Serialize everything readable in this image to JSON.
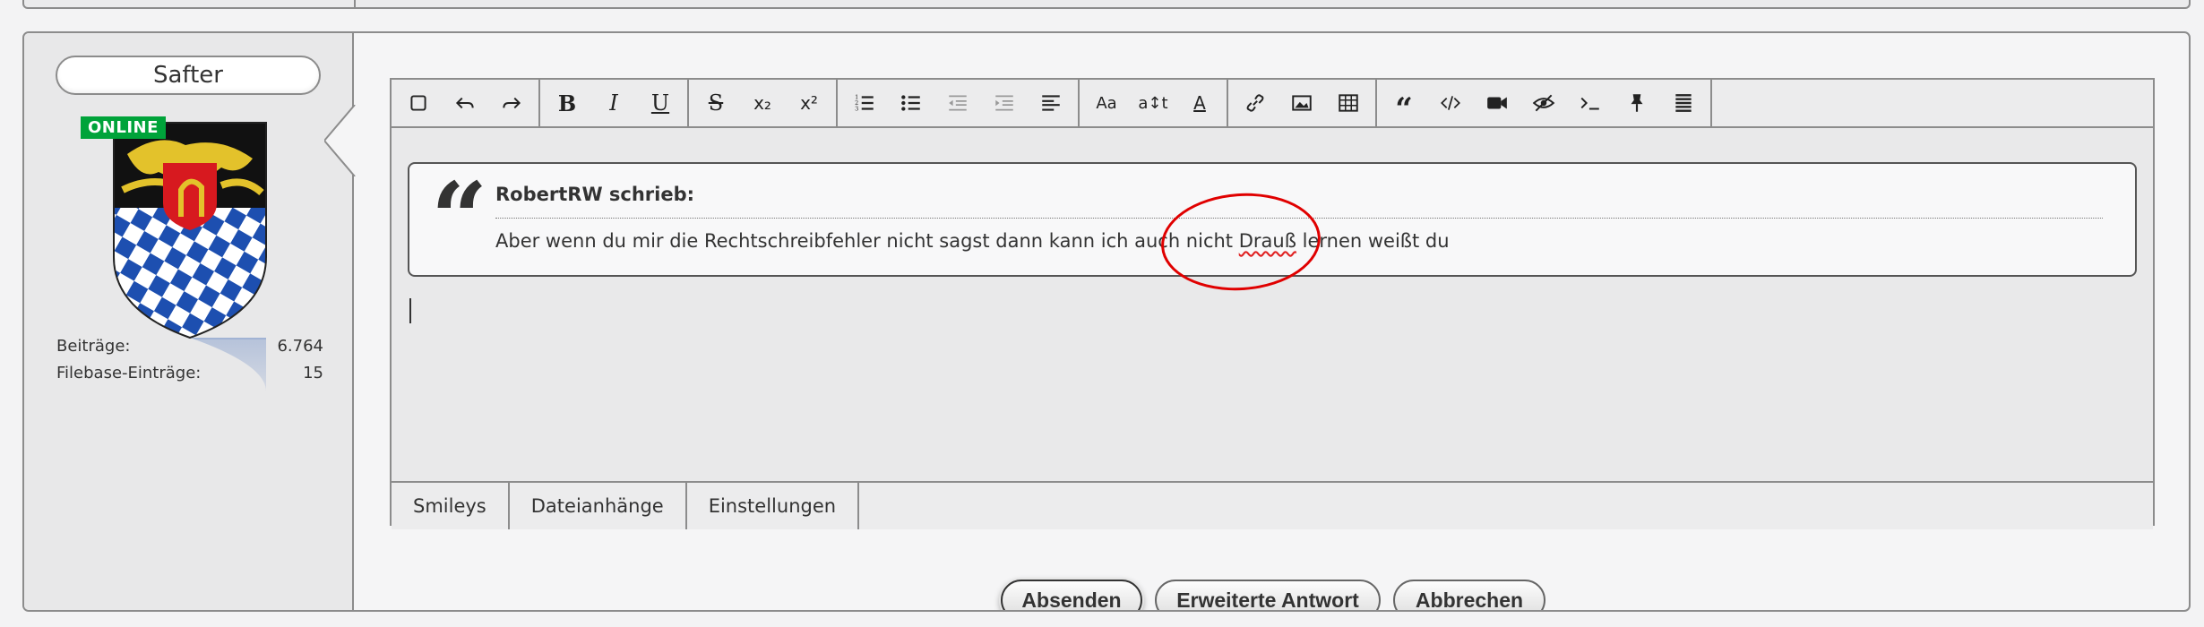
{
  "user": {
    "name": "Safter",
    "online_badge": "ONLINE",
    "stats": [
      {
        "label": "Beiträge:",
        "value": "6.764"
      },
      {
        "label": "Filebase-Einträge:",
        "value": "15"
      }
    ]
  },
  "toolbar": {
    "groups": [
      [
        "checkbox-icon",
        "undo-icon",
        "redo-icon"
      ],
      [
        "bold-icon",
        "italic-icon",
        "underline-icon"
      ],
      [
        "strikethrough-icon",
        "subscript-icon",
        "superscript-icon"
      ],
      [
        "ordered-list-icon",
        "unordered-list-icon",
        "outdent-icon",
        "indent-icon",
        "align-icon"
      ],
      [
        "font-family-icon",
        "font-size-icon",
        "font-color-icon"
      ],
      [
        "link-icon",
        "image-icon",
        "table-icon"
      ],
      [
        "quote-icon",
        "code-icon",
        "video-icon",
        "spoiler-icon",
        "inline-code-icon",
        "pin-icon",
        "justify-icon"
      ]
    ],
    "labels": {
      "bold": "B",
      "italic": "I",
      "underline": "U",
      "strike": "S",
      "sub": "x₂",
      "sup": "x²",
      "font_family": "Aa",
      "font_size": "a↕t",
      "font_color": "A"
    }
  },
  "quote": {
    "author": "RobertRW schrieb:",
    "text_before": "Aber wenn du mir die Rechtschreibfehler nicht sagst dann kann ich auch nicht ",
    "misspelled": "Drauß",
    "text_after": " lernen weißt du"
  },
  "editor_tabs": [
    "Smileys",
    "Dateianhänge",
    "Einstellungen"
  ],
  "actions": {
    "submit": "Absenden",
    "extended": "Erweiterte Antwort",
    "cancel": "Abbrechen"
  },
  "colors": {
    "online": "#00a33a",
    "annotation": "#e00000",
    "border": "#8c8c8c"
  }
}
